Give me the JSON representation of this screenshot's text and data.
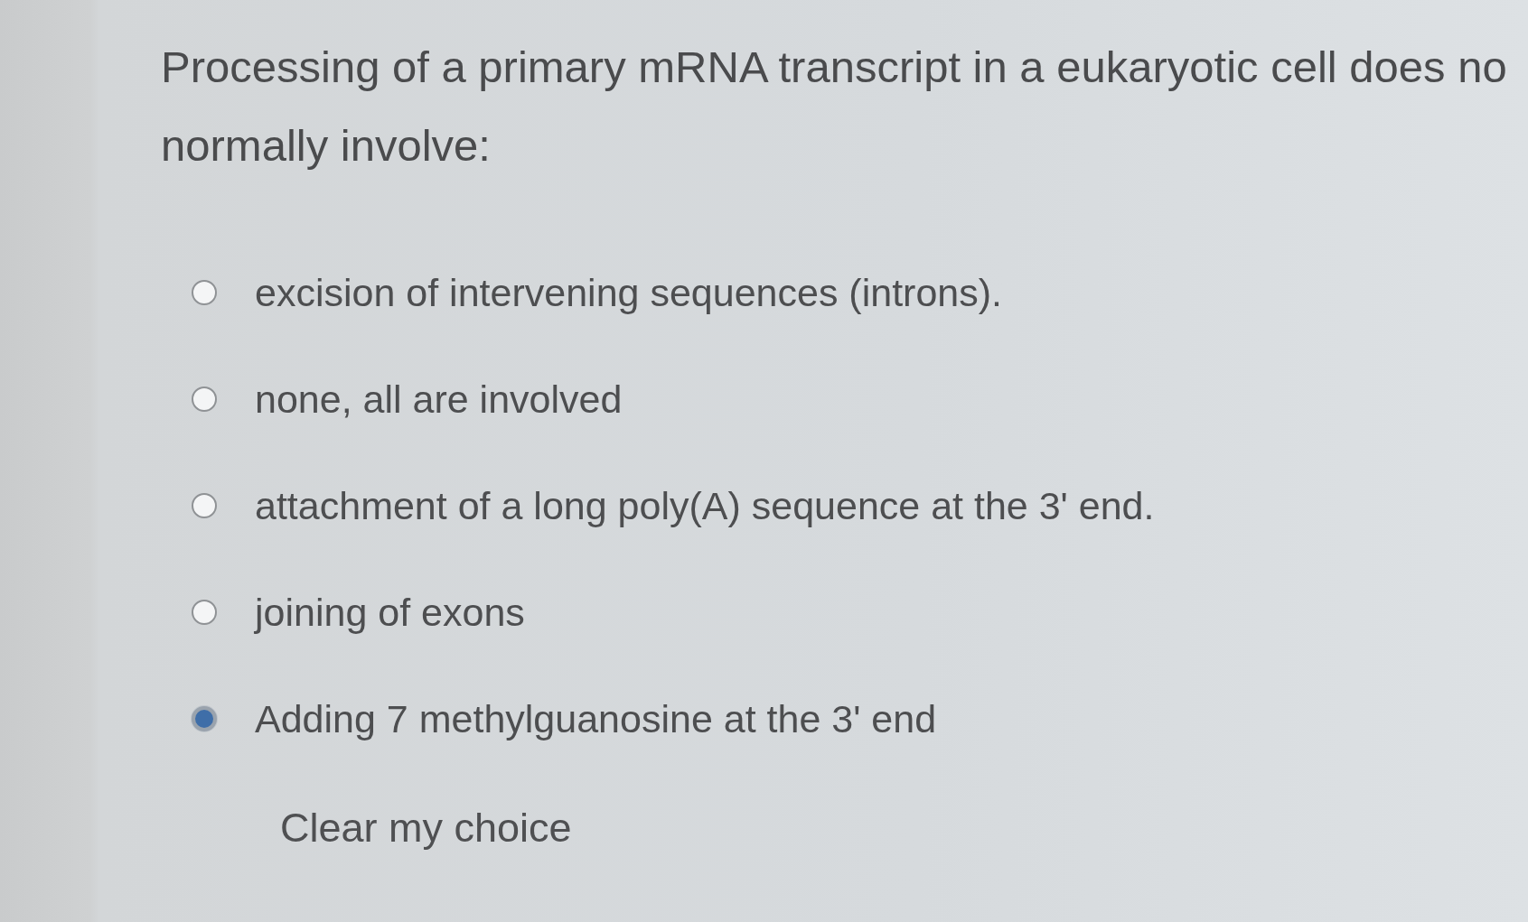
{
  "question": {
    "lines": [
      "Processing of a primary mRNA transcript in a eukaryotic cell does no",
      "normally involve:"
    ]
  },
  "options": [
    {
      "label": "excision of intervening sequences (introns).",
      "selected": false
    },
    {
      "label": "none, all are involved",
      "selected": false
    },
    {
      "label": "attachment of a long poly(A) sequence at the 3' end.",
      "selected": false
    },
    {
      "label": "joining of exons",
      "selected": false
    },
    {
      "label": "Adding 7 methylguanosine at the 3' end",
      "selected": true
    }
  ],
  "clear_link": "Clear my choice"
}
